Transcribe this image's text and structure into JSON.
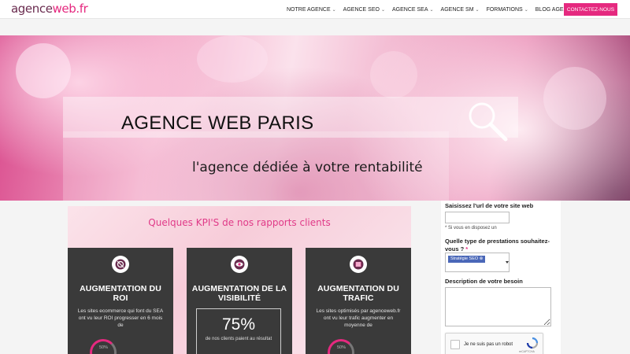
{
  "header": {
    "logo_part1": "agence",
    "logo_part2": "web.fr",
    "nav": [
      {
        "label": "NOTRE AGENCE",
        "chevron": true
      },
      {
        "label": "AGENCE SEO",
        "chevron": true
      },
      {
        "label": "AGENCE SEA",
        "chevron": true
      },
      {
        "label": "AGENCE SM",
        "chevron": true
      },
      {
        "label": "FORMATIONS",
        "chevron": true
      },
      {
        "label": "BLOG AGENCE WEB",
        "chevron": false
      }
    ],
    "chevron_glyph": "⌄",
    "contact_label": "CONTACTEZ-NOUS"
  },
  "hero": {
    "title": "AGENCE WEB PARIS",
    "subtitle": "l'agence dédiée à votre rentabilité"
  },
  "kpi": {
    "heading": "Quelques KPI'S de nos rapports clients",
    "cards": [
      {
        "icon": "roi-icon",
        "title": "AUGMENTATION DU ROI",
        "description": "Les sites ecommerce qui font du SEA ont vu leur ROI progresser en 6 mois de",
        "ring_label": "50%"
      },
      {
        "icon": "eye-icon",
        "title": "AUGMENTATION DE LA VISIBILITÉ",
        "stat_value": "75%",
        "stat_caption": "de nos clients paient au résultat"
      },
      {
        "icon": "traffic-icon",
        "title": "AUGMENTATION DU TRAFIC",
        "description": "Les sites optimisés par agenceweb.fr ont vu leur trafic augmenter en moyenne de",
        "ring_label": "50%"
      }
    ]
  },
  "form": {
    "url_label": "Saisissez l'url de votre site web",
    "url_value": "",
    "url_hint": "* Si vous en disposez un",
    "service_label": "Quelle type de prestations souhaitez-vous ?",
    "required_mark": "*",
    "service_selected": "Stratégie SEO",
    "service_tag_remove": "⊗",
    "description_label": "Description de votre besoin",
    "captcha_text": "Je ne suis pas un robot",
    "captcha_brand": "reCAPTCHA"
  },
  "colors": {
    "brand_pink": "#e5297f",
    "brand_plum": "#6a2c4f",
    "card_dark": "#3a3a3a",
    "tag_blue": "#4a67b8"
  }
}
